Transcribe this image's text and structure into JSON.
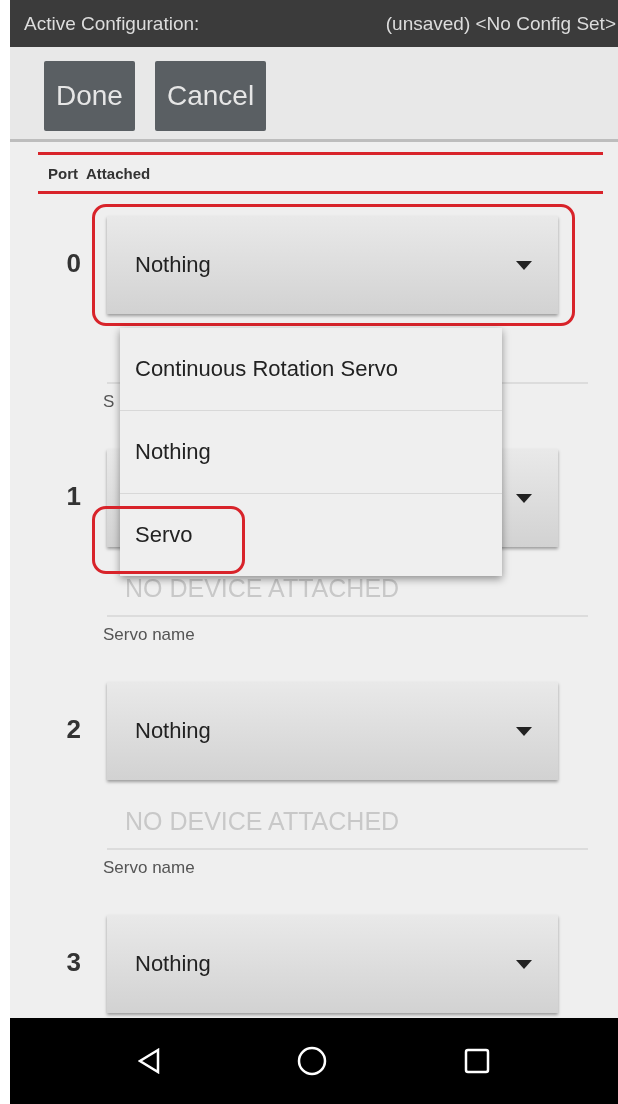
{
  "status_bar": {
    "label": "Active Configuration:",
    "value": "(unsaved) <No Config Set>"
  },
  "toolbar": {
    "buttons": [
      "Done",
      "Cancel"
    ]
  },
  "table_header": {
    "columns": [
      "Port",
      "Attached"
    ]
  },
  "ports": [
    {
      "number": "0",
      "value": "Nothing",
      "highlighted": true,
      "expanded": true,
      "name_label": "S"
    },
    {
      "number": "1",
      "placeholder": "NO DEVICE ATTACHED",
      "name_label": "Servo name"
    },
    {
      "number": "2",
      "value": "Nothing",
      "highlighted": false,
      "placeholder": "NO DEVICE ATTACHED",
      "name_label": "Servo name"
    },
    {
      "number": "3",
      "value": "Nothing",
      "highlighted": false
    }
  ],
  "dropdown_menu": {
    "options": [
      {
        "label": "Continuous Rotation Servo",
        "highlighted": false
      },
      {
        "label": "Nothing",
        "highlighted": false
      },
      {
        "label": "Servo",
        "highlighted": true
      }
    ]
  }
}
